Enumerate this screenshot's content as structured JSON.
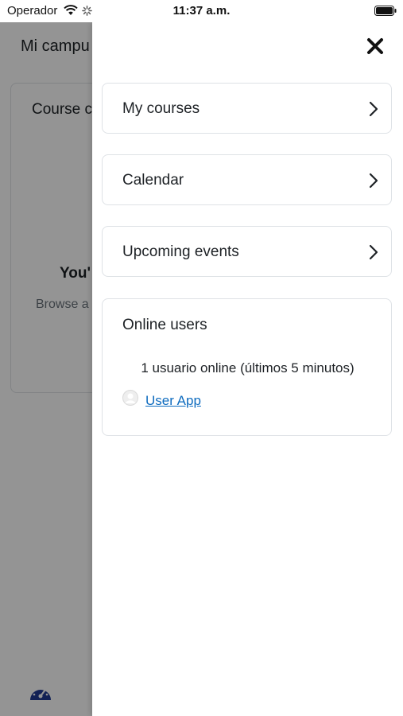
{
  "status_bar": {
    "carrier": "Operador",
    "time": "11:37 a.m."
  },
  "background": {
    "page_title": "Mi campu",
    "card_title": "Course c",
    "empty_title": "You'",
    "empty_text": "Browse a"
  },
  "drawer": {
    "close_icon": "close-icon",
    "blocks": [
      {
        "label": "My courses"
      },
      {
        "label": "Calendar"
      },
      {
        "label": "Upcoming events"
      }
    ],
    "online_users": {
      "title": "Online users",
      "count_text": "1 usuario online (últimos 5 minutos)",
      "users": [
        {
          "name": "User App"
        }
      ]
    }
  },
  "colors": {
    "link": "#0f6cbf",
    "text": "#1d2125",
    "border": "#dee2e6",
    "overlay": "rgba(0,0,0,0.42)"
  }
}
